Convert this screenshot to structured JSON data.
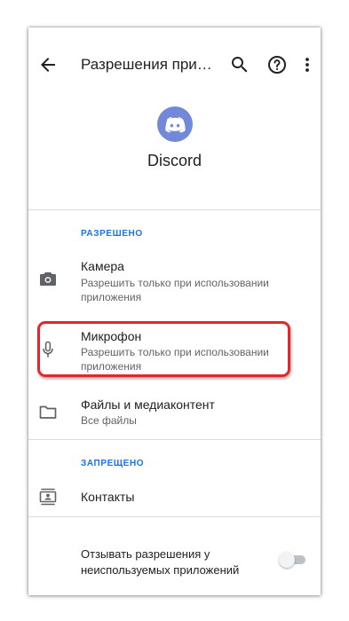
{
  "appbar": {
    "title": "Разрешения при…",
    "back_icon": "arrow-back-icon",
    "search_icon": "search-icon",
    "help_icon": "help-icon",
    "more_icon": "more-vert-icon"
  },
  "app": {
    "name": "Discord",
    "icon": "discord-logo-icon",
    "icon_color": "#7289da"
  },
  "sections": {
    "allowed_header": "РАЗРЕШЕНО",
    "denied_header": "ЗАПРЕЩЕНО"
  },
  "permissions": {
    "camera": {
      "label": "Камера",
      "status": "Разрешить только при использовании приложения",
      "icon": "camera-icon"
    },
    "microphone": {
      "label": "Микрофон",
      "status": "Разрешить только при использовании приложения",
      "icon": "microphone-icon"
    },
    "files": {
      "label": "Файлы и медиаконтент",
      "status": "Все файлы",
      "icon": "folder-icon"
    },
    "contacts": {
      "label": "Контакты",
      "icon": "contacts-icon"
    }
  },
  "revoke": {
    "label": "Отзывать разрешения у неиспользуемых приложений",
    "enabled": false
  },
  "colors": {
    "accent": "#1a73e8",
    "highlight": "#e3262a",
    "text_secondary": "#5f6368"
  }
}
